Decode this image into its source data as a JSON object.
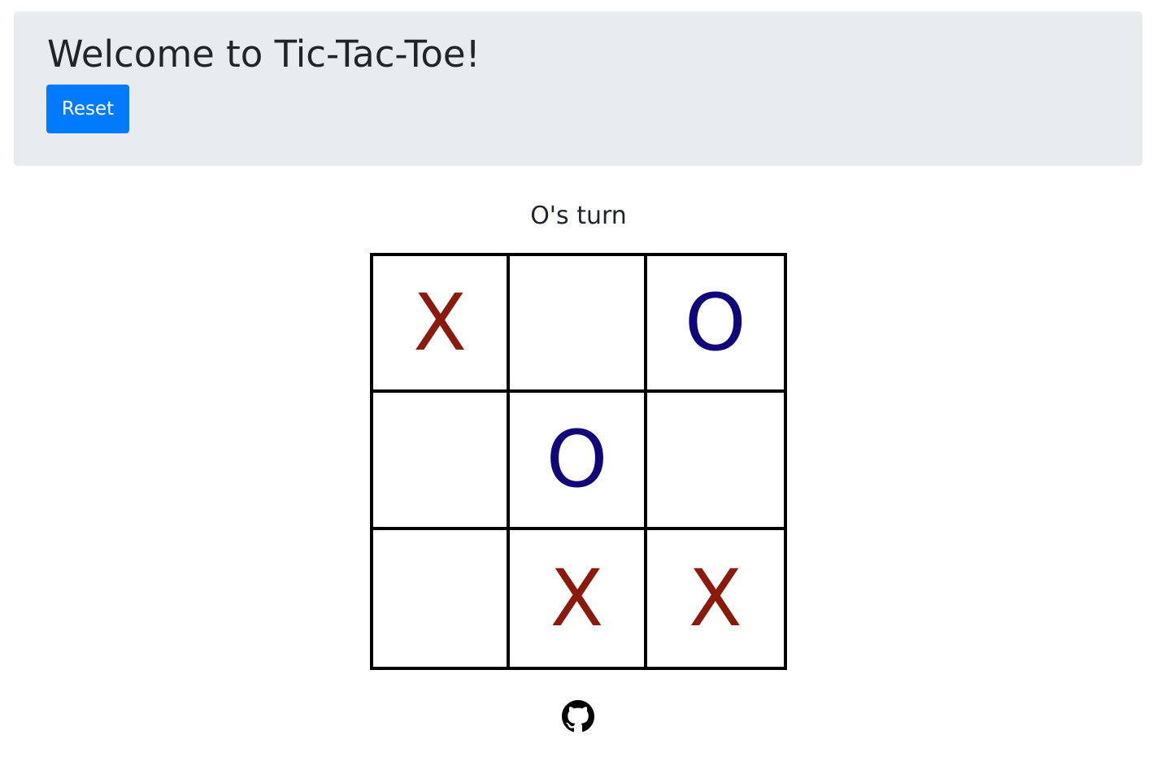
{
  "header": {
    "title": "Welcome to Tic-Tac-Toe!",
    "reset_label": "Reset"
  },
  "status": "O's turn",
  "board": {
    "cells": [
      {
        "value": "X",
        "player": "x"
      },
      {
        "value": "",
        "player": ""
      },
      {
        "value": "O",
        "player": "o"
      },
      {
        "value": "",
        "player": ""
      },
      {
        "value": "O",
        "player": "o"
      },
      {
        "value": "",
        "player": ""
      },
      {
        "value": "",
        "player": ""
      },
      {
        "value": "X",
        "player": "x"
      },
      {
        "value": "X",
        "player": "x"
      }
    ]
  },
  "footer": {
    "icon": "github-icon"
  },
  "colors": {
    "x_mark": "#8b1a0c",
    "o_mark": "#10067a",
    "accent": "#007bff",
    "jumbotron_bg": "#e9ecef"
  }
}
